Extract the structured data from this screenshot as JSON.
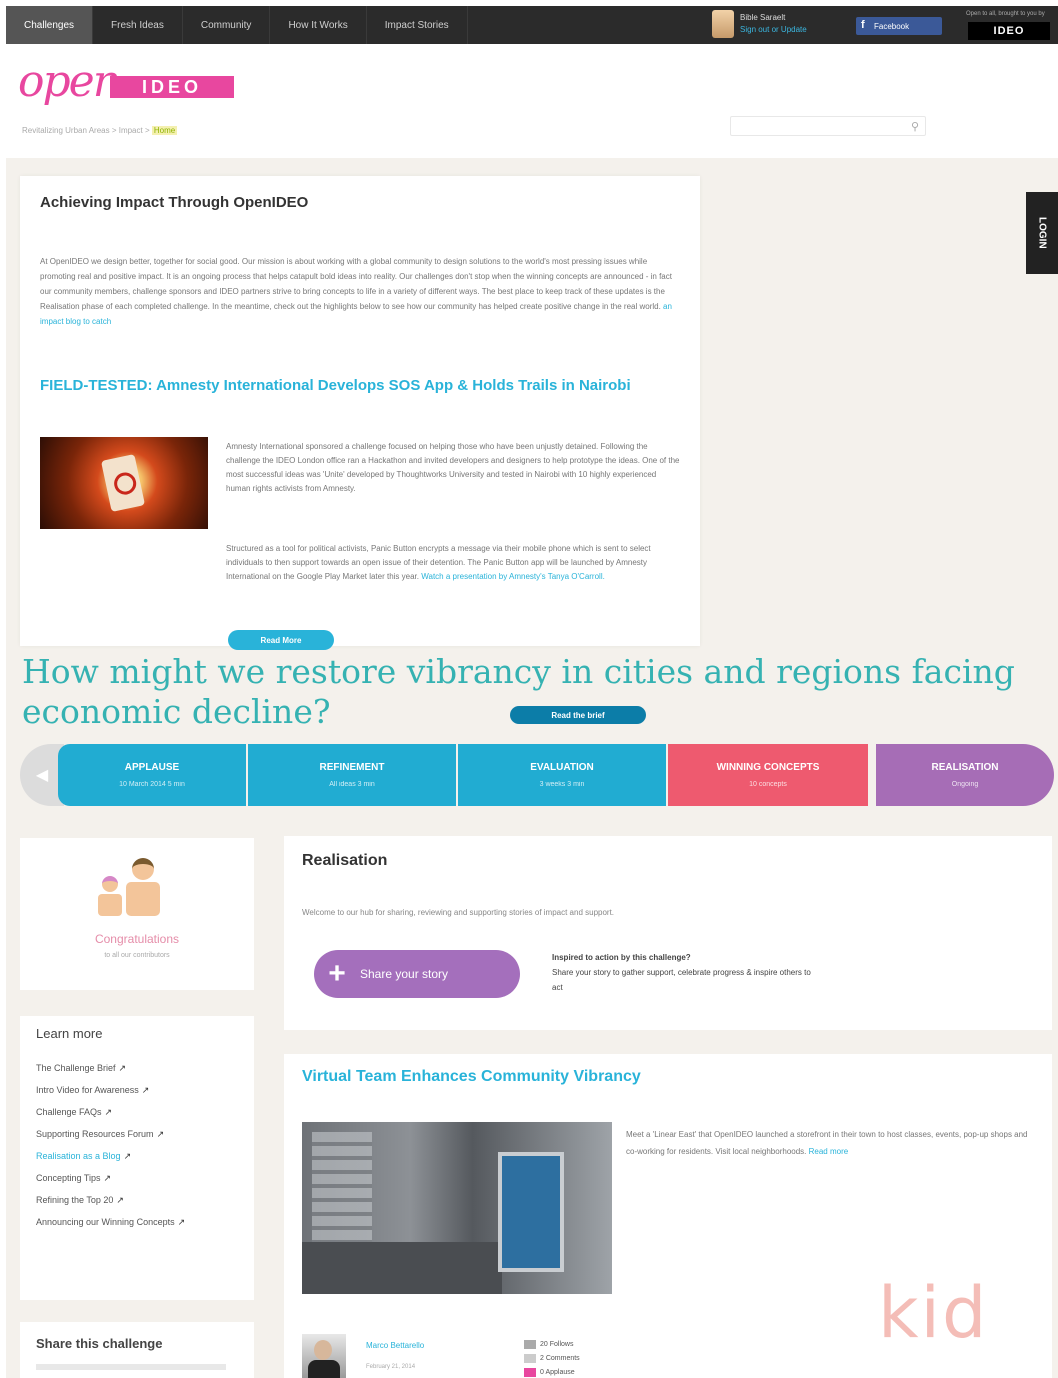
{
  "topbar": {
    "nav": [
      "Challenges",
      "Fresh Ideas",
      "Community",
      "How It Works",
      "Impact Stories"
    ],
    "user_name": "Bible Saraelt",
    "user_links": "Sign out or Update",
    "facebook_label": "Facebook",
    "ideo_logo": "IDEO",
    "ideo_tagline": "Open to all, brought to you by"
  },
  "header": {
    "logo_open": "open",
    "logo_ideo": "IDEO",
    "breadcrumb_path": "Revitalizing Urban Areas > Impact > ",
    "breadcrumb_current": "Home",
    "search_placeholder": "Search"
  },
  "impact": {
    "title": "Achieving Impact Through OpenIDEO",
    "intro": "At OpenIDEO we design better, together for social good. Our mission is about working with a global community to design solutions to the world's most pressing issues while promoting real and positive impact. It is an ongoing process that helps catapult bold ideas into reality. Our challenges don't stop when the winning concepts are announced - in fact our community members, challenge sponsors and IDEO partners strive to bring concepts to life in a variety of different ways. The best place to keep track of these updates is the Realisation phase of each completed challenge. In the meantime, check out the highlights below to see how our community has helped create positive change in the real world.",
    "intro_link": "an impact blog to catch",
    "field_title": "FIELD-TESTED: Amnesty International Develops SOS App & Holds Trails in Nairobi",
    "field_p1": "Amnesty International sponsored a challenge focused on helping those who have been unjustly detained. Following the challenge the IDEO London office ran a Hackathon and invited developers and designers to help prototype the ideas. One of the most successful ideas was 'Unite' developed by Thoughtworks University and tested in Nairobi with 10 highly experienced human rights activists from Amnesty.",
    "field_p2": "Structured as a tool for political activists, Panic Button encrypts a message via their mobile phone which is sent to select individuals to then support towards an open issue of their detention. The Panic Button app will be launched by Amnesty International on the Google Play Market later this year.",
    "field_p2_link": "Watch a presentation by Amnesty's Tanya O'Carroll.",
    "read_more": "Read More"
  },
  "challenge": {
    "question": "How might we restore vibrancy in cities and regions facing economic decline?",
    "brief_button": "Read the brief"
  },
  "phases": [
    {
      "label": "APPLAUSE",
      "sub": "10 March 2014 5 min"
    },
    {
      "label": "REFINEMENT",
      "sub": "All ideas 3 min"
    },
    {
      "label": "EVALUATION",
      "sub": "3 weeks 3 min"
    },
    {
      "label": "WINNING CONCEPTS",
      "sub": "10 concepts"
    },
    {
      "label": "REALISATION",
      "sub": "Ongoing"
    }
  ],
  "congrats": {
    "title": "Congratulations",
    "sub": "to all our contributors"
  },
  "learn_more": {
    "title": "Learn more",
    "items": [
      {
        "label": "The Challenge Brief",
        "highlight": false
      },
      {
        "label": "Intro Video for Awareness",
        "highlight": false
      },
      {
        "label": "Challenge FAQs",
        "highlight": false
      },
      {
        "label": "Supporting Resources Forum",
        "highlight": false
      },
      {
        "label": "Realisation as a Blog",
        "highlight": true
      },
      {
        "label": "Concepting Tips",
        "highlight": false
      },
      {
        "label": "Refining the Top 20",
        "highlight": false
      },
      {
        "label": "Announcing our Winning Concepts",
        "highlight": false
      }
    ],
    "ext_icon": "↗"
  },
  "share": {
    "title": "Share this challenge"
  },
  "realisation": {
    "title": "Realisation",
    "text": "Welcome to our hub for sharing, reviewing and supporting stories of impact and support.",
    "story_button": "Share your story",
    "inspired_q": "Inspired to action by this challenge?",
    "inspired_text": "Share your story to gather support, celebrate progress & inspire others to act"
  },
  "vt": {
    "title": "Virtual Team Enhances Community Vibrancy",
    "text": "Meet a 'Linear East' that OpenIDEO launched a storefront in their town to host classes, events, pop-up shops and co-working for residents. Visit local neighborhoods.",
    "link": "Read more",
    "author_name": "Marco Bettarello",
    "author_date": "February 21, 2014",
    "stats": [
      "20 Follows",
      "2 Comments",
      "0 Applause"
    ]
  },
  "login_tab": "LOGIN",
  "watermark": "kid",
  "colors": {
    "accent": "#29b3d9",
    "pink": "#e8479f",
    "teal_heading": "#35b2b2",
    "coral": "#ee5a6f",
    "purple": "#a66db6"
  }
}
